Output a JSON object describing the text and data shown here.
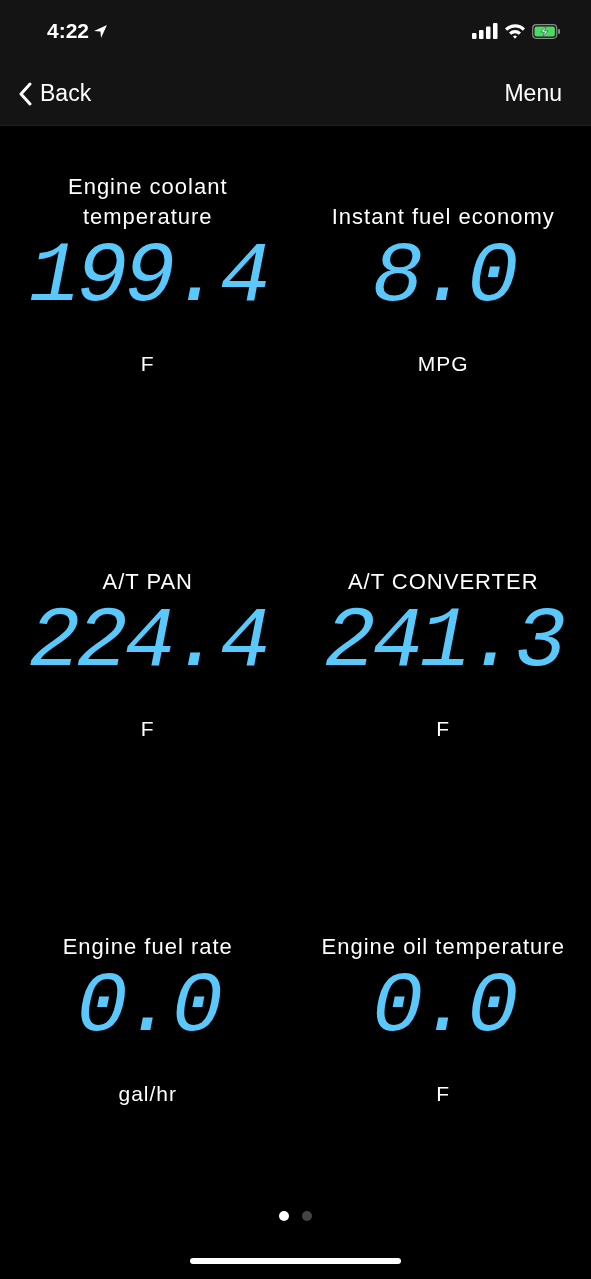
{
  "status_bar": {
    "time": "4:22"
  },
  "nav": {
    "back": "Back",
    "menu": "Menu"
  },
  "gauges": [
    {
      "title": "Engine coolant temperature",
      "value": "199.4",
      "unit": "F"
    },
    {
      "title": "Instant fuel economy",
      "value": "8.0",
      "unit": "MPG"
    },
    {
      "title": "A/T PAN",
      "value": "224.4",
      "unit": "F"
    },
    {
      "title": "A/T CONVERTER",
      "value": "241.3",
      "unit": "F"
    },
    {
      "title": "Engine fuel rate",
      "value": "0.0",
      "unit": "gal/hr"
    },
    {
      "title": "Engine oil temperature",
      "value": "0.0",
      "unit": "F"
    }
  ],
  "pages": [
    {
      "selected": true
    },
    {
      "selected": false
    }
  ]
}
